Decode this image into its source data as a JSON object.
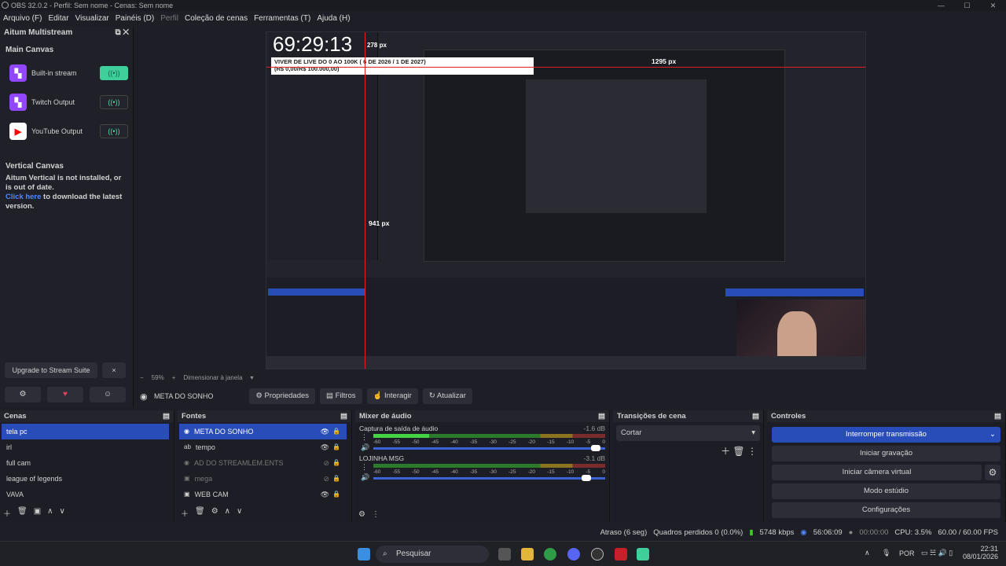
{
  "window": {
    "title": "OBS 32.0.2 - Perfil: Sem nome - Cenas: Sem nome"
  },
  "menu": [
    {
      "label": "Arquivo (F)",
      "dim": false
    },
    {
      "label": "Editar",
      "dim": false
    },
    {
      "label": "Visualizar",
      "dim": false
    },
    {
      "label": "Painéis (D)",
      "dim": false
    },
    {
      "label": "Perfil",
      "dim": true
    },
    {
      "label": "Coleção de cenas",
      "dim": false
    },
    {
      "label": "Ferramentas (T)",
      "dim": false
    },
    {
      "label": "Ajuda (H)",
      "dim": false
    }
  ],
  "dock": {
    "title": "Aitum Multistream",
    "main_canvas": "Main Canvas",
    "outputs": [
      {
        "label": "Built-in stream",
        "icon": "twitch-icon",
        "on": true
      },
      {
        "label": "Twitch Output",
        "icon": "twitch-icon",
        "on": false
      },
      {
        "label": "YouTube Output",
        "icon": "youtube-icon",
        "on": false
      }
    ],
    "vertical_canvas": "Vertical Canvas",
    "vertical_msg": "Aitum Vertical is not installed, or is out of date.",
    "click_here": "Click here",
    "download_msg": " to download the latest version.",
    "upgrade": "Upgrade to Stream Suite",
    "close": "×"
  },
  "preview": {
    "timer": "69:29:13",
    "goal": "VIVER DE LIVE DO 0 AO 100K ( 6 DE 2026 / 1 DE 2027)",
    "goal_sub": "(R$ 0,00/R$ 100.000,00)",
    "px_top": "1295 px",
    "px_left": "941 px",
    "px_small": "278 px"
  },
  "zoom": {
    "value": "59%",
    "mode": "Dimensionar à janela"
  },
  "toolbar": {
    "source": "META DO SONHO",
    "props": "Propriedades",
    "filters": "Filtros",
    "interact": "Interagir",
    "refresh": "Atualizar"
  },
  "scenes": {
    "title": "Cenas",
    "items": [
      "tela pc",
      "irl",
      "full cam",
      "league of legends",
      "VAVA"
    ]
  },
  "sources": {
    "title": "Fontes",
    "items": [
      {
        "label": "META DO SONHO",
        "dim": false
      },
      {
        "label": "tempo",
        "dim": false
      },
      {
        "label": "AD DO STREAMLEM.ENTS",
        "dim": true
      },
      {
        "label": "mega",
        "dim": true
      },
      {
        "label": "WEB CAM",
        "dim": false
      }
    ]
  },
  "mixer": {
    "title": "Mixer de áudio",
    "channels": [
      {
        "name": "Captura de saída de áudio",
        "db": "-1.6 dB",
        "level": 0.24,
        "volume": 0.98
      },
      {
        "name": "LOJINHA MSG",
        "db": "-3.1 dB",
        "level": 0,
        "volume": 0.94
      }
    ],
    "ticks": [
      "-60",
      "-55",
      "-50",
      "-45",
      "-40",
      "-35",
      "-30",
      "-25",
      "-20",
      "-15",
      "-10",
      "-5",
      "0"
    ]
  },
  "transitions": {
    "title": "Transições de cena",
    "selected": "Cortar"
  },
  "controls": {
    "title": "Controles",
    "stop_stream": "Interromper transmissão",
    "start_rec": "Iniciar gravação",
    "virtual_cam": "Iniciar câmera virtual",
    "studio": "Modo estúdio",
    "settings": "Configurações"
  },
  "status": {
    "delay": "Atraso (6 seg)",
    "dropped": "Quadros perdidos 0 (0.0%)",
    "bitrate": "5748 kbps",
    "stream_time": "56:06:09",
    "rec_time": "00:00:00",
    "cpu": "CPU: 3.5%",
    "fps": "60.00 / 60.00 FPS"
  },
  "taskbar": {
    "search": "Pesquisar",
    "lang": "POR",
    "time": "22:31",
    "date": "08/01/2026"
  },
  "colors": {
    "accent": "#284cb8",
    "twitch": "#9146ff",
    "youtube": "#ff0000",
    "live": "#3fcf9a"
  }
}
